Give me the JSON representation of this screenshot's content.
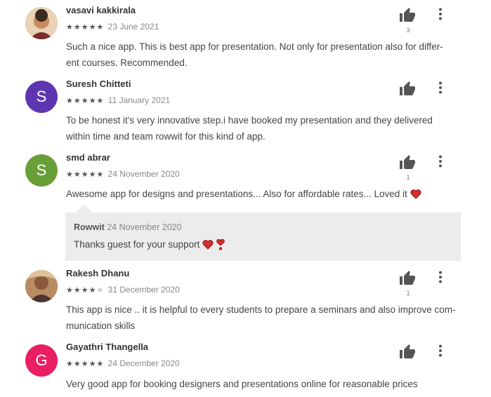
{
  "reviews": [
    {
      "name": "vasavi kakkirala",
      "stars_filled": 5,
      "date": "23 June 2021",
      "text_line1": "Such a nice app. This is best app for presentation. Not only for presentation also for differ-",
      "text_line2": "ent courses. Recommended.",
      "helpful_count": "3",
      "avatar": "photo",
      "avatar_color": "#8a5a3a"
    },
    {
      "name": "Suresh Chitteti",
      "stars_filled": 5,
      "date": "11 January 2021",
      "text_line1": "To be honest it's very innovative step.i have booked my presentation and they delivered",
      "text_line2": "within time and team rowwit for this kind of app.",
      "helpful_count": "",
      "avatar_letter": "S",
      "avatar_color": "#5e35b1"
    },
    {
      "name": "smd abrar",
      "stars_filled": 5,
      "date": "24 November 2020",
      "text_line1": "Awesome app for designs and presentations... Also for affordable rates... Loved it",
      "helpful_count": "1",
      "avatar_letter": "S",
      "avatar_color": "#689f38"
    },
    {
      "name": "Rakesh Dhanu",
      "stars_filled": 4,
      "date": "31 December 2020",
      "text_line1": "This app is nice .. it is helpful to every students to prepare a seminars and also improve com-",
      "text_line2": "munication skills",
      "helpful_count": "1",
      "avatar": "photo",
      "avatar_color": "#6d4c41"
    },
    {
      "name": "Gayathri Thangella",
      "stars_filled": 5,
      "date": "24 December 2020",
      "text_line1": "Very good app for booking designers and presentations online for reasonable prices",
      "helpful_count": "",
      "avatar_letter": "G",
      "avatar_color": "#e91e63"
    }
  ],
  "reply": {
    "author": "Rowwit",
    "date": "24 November 2020",
    "text": "Thanks guest for your support"
  },
  "icons": {
    "thumb": "thumbs-up-icon",
    "more": "more-vertical-icon",
    "heart": "heart-icon",
    "star": "star-icon"
  },
  "colors": {
    "icon": "#555555",
    "heart": "#d32f2f",
    "reply_bg": "#ececec"
  }
}
